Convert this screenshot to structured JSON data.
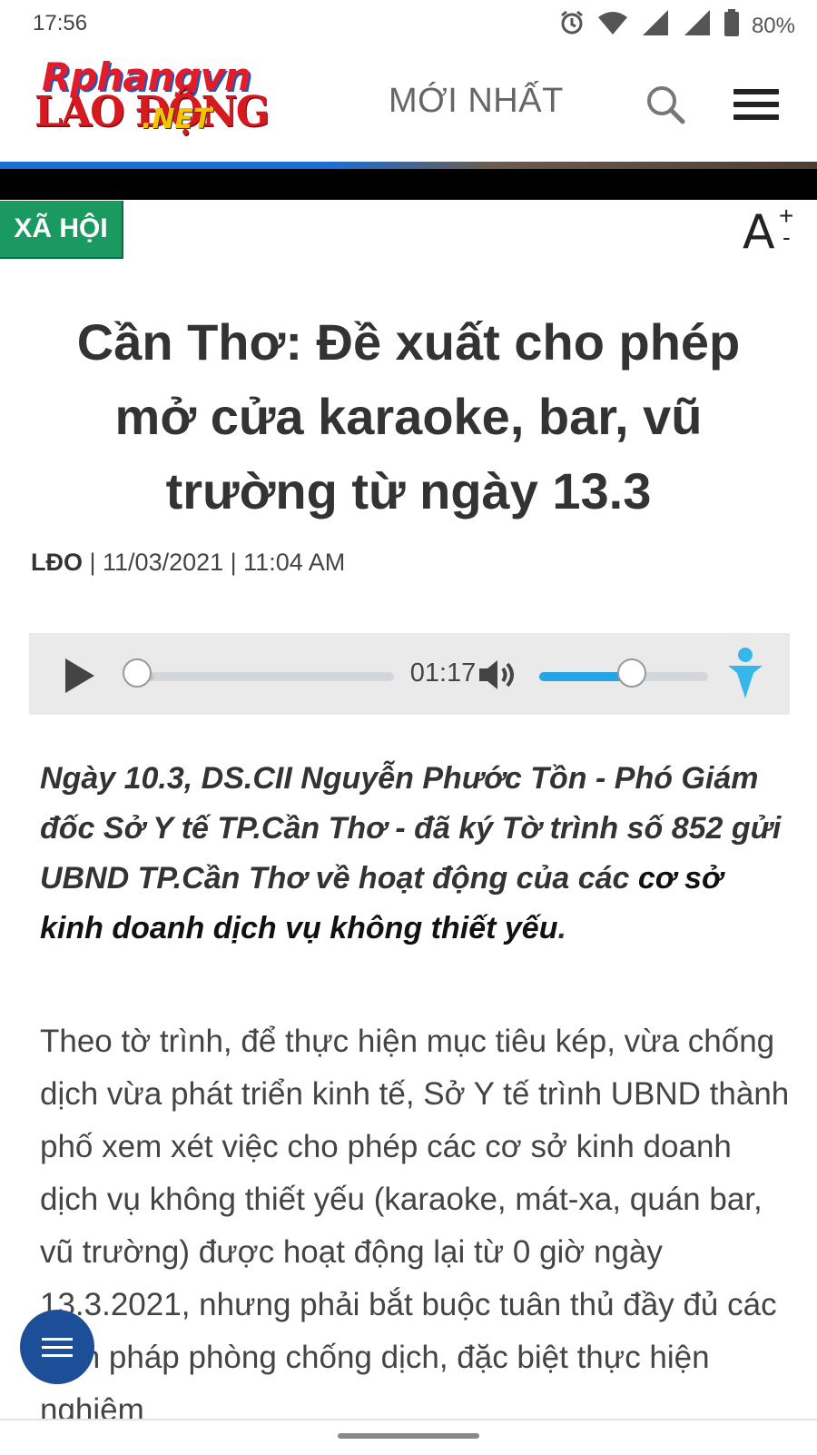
{
  "status_bar": {
    "time": "17:56",
    "battery": "80%",
    "icons": [
      "alarm-icon",
      "wifi-icon",
      "signal-icon",
      "signal-icon",
      "battery-icon"
    ]
  },
  "header": {
    "logo_top": "Rphangvn",
    "logo_bottom": "LAO ĐỘNG",
    "logo_net": ".NET",
    "nav_latest": "MỚI NHẤT",
    "icons": [
      "search-icon",
      "hamburger-menu-icon"
    ]
  },
  "article": {
    "category": "XÃ HỘI",
    "font_control": {
      "letter": "A",
      "plus": "+",
      "minus": "-"
    },
    "title": "Cần Thơ: Đề xuất cho phép mở cửa karaoke, bar, vũ trường từ ngày 13.3",
    "source": "LĐO",
    "date_sep": " | 11/03/2021 | 11:04 AM",
    "lead_normal": "Ngày 10.3, DS.CII Nguyễn Phước Tồn - Phó Giám đốc Sở Y tế TP.Cần Thơ - đã ký Tờ trình số 852 gửi UBND TP.Cần Thơ về hoạt động của các ",
    "lead_link": "cơ sở kinh doanh dịch vụ không thiết yếu",
    "lead_end": ".",
    "body": "Theo tờ trình, để thực hiện mục tiêu kép, vừa chống dịch vừa phát triển kinh tế, Sở Y tế trình UBND thành phố xem xét việc cho phép các cơ sở kinh doanh dịch vụ không thiết yếu (karaoke, mát-xa, quán bar, vũ trường) được hoạt động lại từ 0 giờ ngày 13.3.2021, nhưng phải bắt buộc tuân thủ đầy đủ các biện pháp phòng chống dịch, đặc biệt thực hiện nghiêm"
  },
  "audio_player": {
    "duration": "01:17",
    "progress": 0.0,
    "volume": 0.55,
    "icons": [
      "play-icon",
      "volume-icon",
      "accessibility-icon"
    ]
  },
  "colors": {
    "category_bg": "#1a9a61",
    "fab_bg": "#1c4f97",
    "volume_fill": "#26a5e6"
  }
}
